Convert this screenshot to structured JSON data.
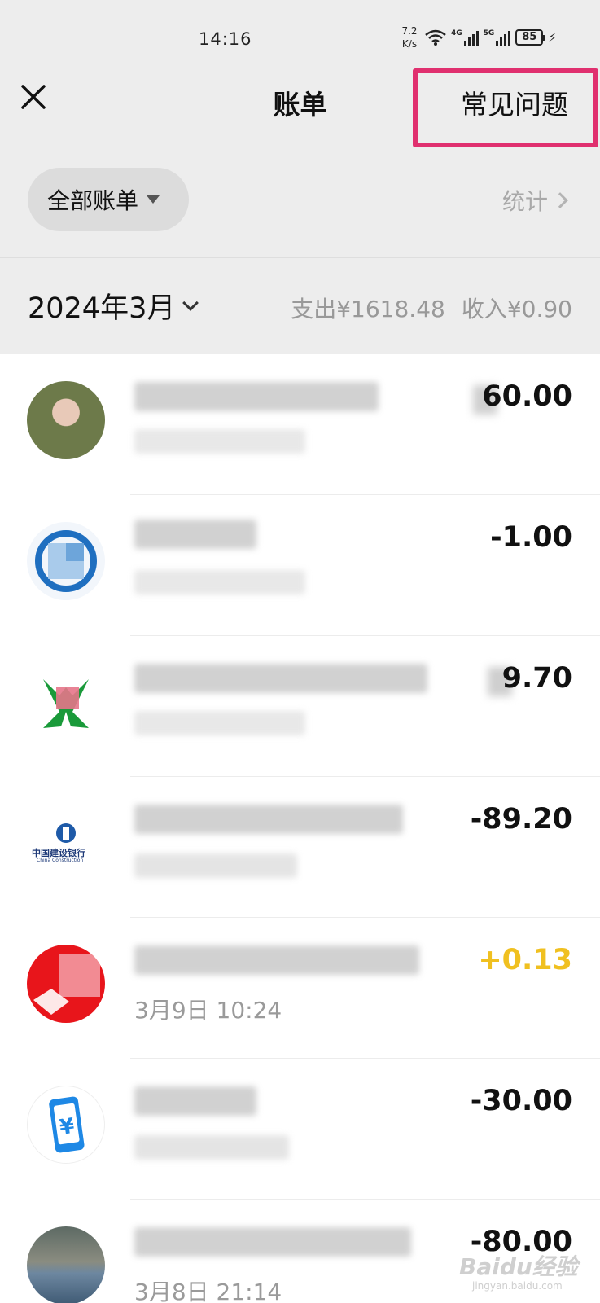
{
  "status_bar": {
    "time": "14:16",
    "net_speed": "7.2\nK/s",
    "net_type_1": "4G",
    "net_type_2": "5G",
    "battery": "85"
  },
  "nav": {
    "title": "账单",
    "faq_label": "常见问题",
    "highlight_color": "#e0306f"
  },
  "filter": {
    "label": "全部账单",
    "stats_label": "统计"
  },
  "month_summary": {
    "month": "2024年3月",
    "expense": "支出¥1618.48",
    "income": "收入¥0.90"
  },
  "transactions": [
    {
      "amount": "60.00",
      "time": "",
      "avatar": "person-photo-avatar"
    },
    {
      "amount": "-1.00",
      "time": "",
      "avatar": "blue-logo-avatar"
    },
    {
      "amount": "9.70",
      "time": "",
      "avatar": "green-logo-avatar"
    },
    {
      "amount": "-89.20",
      "time": "",
      "avatar": "bank-logo-avatar"
    },
    {
      "amount": "+0.13",
      "time": "3月9日 10:24",
      "avatar": "red-logo-avatar",
      "income": true
    },
    {
      "amount": "-30.00",
      "time": "",
      "avatar": "yen-phone-avatar"
    },
    {
      "amount": "-80.00",
      "time": "3月8日 21:14",
      "avatar": "landscape-photo-avatar"
    }
  ],
  "bank_logo_text": "中国建设银行",
  "bank_logo_subtext": "China Construction",
  "watermark": {
    "main": "Baidu经验",
    "sub": "jingyan.baidu.com"
  },
  "colors": {
    "income_amount": "#f0c020",
    "background": "#ededed",
    "list_bg": "#ffffff"
  }
}
